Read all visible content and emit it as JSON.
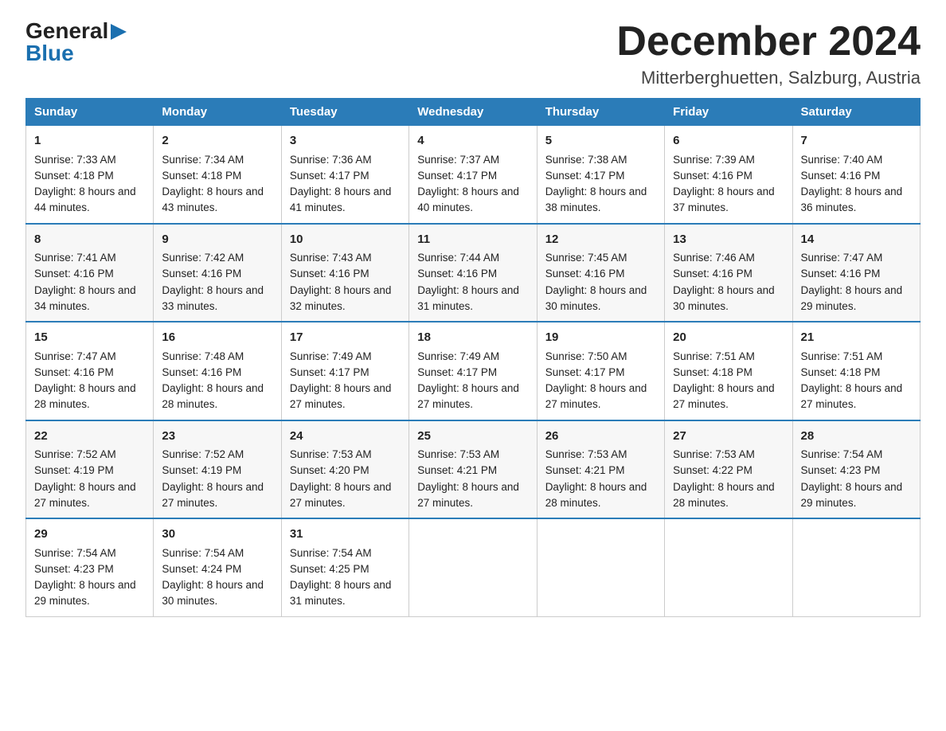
{
  "logo": {
    "line1": "General",
    "line2": "Blue",
    "arrow": "▶"
  },
  "header": {
    "title": "December 2024",
    "subtitle": "Mitterberghuetten, Salzburg, Austria"
  },
  "days_of_week": [
    "Sunday",
    "Monday",
    "Tuesday",
    "Wednesday",
    "Thursday",
    "Friday",
    "Saturday"
  ],
  "weeks": [
    [
      {
        "day": "1",
        "sunrise": "Sunrise: 7:33 AM",
        "sunset": "Sunset: 4:18 PM",
        "daylight": "Daylight: 8 hours and 44 minutes."
      },
      {
        "day": "2",
        "sunrise": "Sunrise: 7:34 AM",
        "sunset": "Sunset: 4:18 PM",
        "daylight": "Daylight: 8 hours and 43 minutes."
      },
      {
        "day": "3",
        "sunrise": "Sunrise: 7:36 AM",
        "sunset": "Sunset: 4:17 PM",
        "daylight": "Daylight: 8 hours and 41 minutes."
      },
      {
        "day": "4",
        "sunrise": "Sunrise: 7:37 AM",
        "sunset": "Sunset: 4:17 PM",
        "daylight": "Daylight: 8 hours and 40 minutes."
      },
      {
        "day": "5",
        "sunrise": "Sunrise: 7:38 AM",
        "sunset": "Sunset: 4:17 PM",
        "daylight": "Daylight: 8 hours and 38 minutes."
      },
      {
        "day": "6",
        "sunrise": "Sunrise: 7:39 AM",
        "sunset": "Sunset: 4:16 PM",
        "daylight": "Daylight: 8 hours and 37 minutes."
      },
      {
        "day": "7",
        "sunrise": "Sunrise: 7:40 AM",
        "sunset": "Sunset: 4:16 PM",
        "daylight": "Daylight: 8 hours and 36 minutes."
      }
    ],
    [
      {
        "day": "8",
        "sunrise": "Sunrise: 7:41 AM",
        "sunset": "Sunset: 4:16 PM",
        "daylight": "Daylight: 8 hours and 34 minutes."
      },
      {
        "day": "9",
        "sunrise": "Sunrise: 7:42 AM",
        "sunset": "Sunset: 4:16 PM",
        "daylight": "Daylight: 8 hours and 33 minutes."
      },
      {
        "day": "10",
        "sunrise": "Sunrise: 7:43 AM",
        "sunset": "Sunset: 4:16 PM",
        "daylight": "Daylight: 8 hours and 32 minutes."
      },
      {
        "day": "11",
        "sunrise": "Sunrise: 7:44 AM",
        "sunset": "Sunset: 4:16 PM",
        "daylight": "Daylight: 8 hours and 31 minutes."
      },
      {
        "day": "12",
        "sunrise": "Sunrise: 7:45 AM",
        "sunset": "Sunset: 4:16 PM",
        "daylight": "Daylight: 8 hours and 30 minutes."
      },
      {
        "day": "13",
        "sunrise": "Sunrise: 7:46 AM",
        "sunset": "Sunset: 4:16 PM",
        "daylight": "Daylight: 8 hours and 30 minutes."
      },
      {
        "day": "14",
        "sunrise": "Sunrise: 7:47 AM",
        "sunset": "Sunset: 4:16 PM",
        "daylight": "Daylight: 8 hours and 29 minutes."
      }
    ],
    [
      {
        "day": "15",
        "sunrise": "Sunrise: 7:47 AM",
        "sunset": "Sunset: 4:16 PM",
        "daylight": "Daylight: 8 hours and 28 minutes."
      },
      {
        "day": "16",
        "sunrise": "Sunrise: 7:48 AM",
        "sunset": "Sunset: 4:16 PM",
        "daylight": "Daylight: 8 hours and 28 minutes."
      },
      {
        "day": "17",
        "sunrise": "Sunrise: 7:49 AM",
        "sunset": "Sunset: 4:17 PM",
        "daylight": "Daylight: 8 hours and 27 minutes."
      },
      {
        "day": "18",
        "sunrise": "Sunrise: 7:49 AM",
        "sunset": "Sunset: 4:17 PM",
        "daylight": "Daylight: 8 hours and 27 minutes."
      },
      {
        "day": "19",
        "sunrise": "Sunrise: 7:50 AM",
        "sunset": "Sunset: 4:17 PM",
        "daylight": "Daylight: 8 hours and 27 minutes."
      },
      {
        "day": "20",
        "sunrise": "Sunrise: 7:51 AM",
        "sunset": "Sunset: 4:18 PM",
        "daylight": "Daylight: 8 hours and 27 minutes."
      },
      {
        "day": "21",
        "sunrise": "Sunrise: 7:51 AM",
        "sunset": "Sunset: 4:18 PM",
        "daylight": "Daylight: 8 hours and 27 minutes."
      }
    ],
    [
      {
        "day": "22",
        "sunrise": "Sunrise: 7:52 AM",
        "sunset": "Sunset: 4:19 PM",
        "daylight": "Daylight: 8 hours and 27 minutes."
      },
      {
        "day": "23",
        "sunrise": "Sunrise: 7:52 AM",
        "sunset": "Sunset: 4:19 PM",
        "daylight": "Daylight: 8 hours and 27 minutes."
      },
      {
        "day": "24",
        "sunrise": "Sunrise: 7:53 AM",
        "sunset": "Sunset: 4:20 PM",
        "daylight": "Daylight: 8 hours and 27 minutes."
      },
      {
        "day": "25",
        "sunrise": "Sunrise: 7:53 AM",
        "sunset": "Sunset: 4:21 PM",
        "daylight": "Daylight: 8 hours and 27 minutes."
      },
      {
        "day": "26",
        "sunrise": "Sunrise: 7:53 AM",
        "sunset": "Sunset: 4:21 PM",
        "daylight": "Daylight: 8 hours and 28 minutes."
      },
      {
        "day": "27",
        "sunrise": "Sunrise: 7:53 AM",
        "sunset": "Sunset: 4:22 PM",
        "daylight": "Daylight: 8 hours and 28 minutes."
      },
      {
        "day": "28",
        "sunrise": "Sunrise: 7:54 AM",
        "sunset": "Sunset: 4:23 PM",
        "daylight": "Daylight: 8 hours and 29 minutes."
      }
    ],
    [
      {
        "day": "29",
        "sunrise": "Sunrise: 7:54 AM",
        "sunset": "Sunset: 4:23 PM",
        "daylight": "Daylight: 8 hours and 29 minutes."
      },
      {
        "day": "30",
        "sunrise": "Sunrise: 7:54 AM",
        "sunset": "Sunset: 4:24 PM",
        "daylight": "Daylight: 8 hours and 30 minutes."
      },
      {
        "day": "31",
        "sunrise": "Sunrise: 7:54 AM",
        "sunset": "Sunset: 4:25 PM",
        "daylight": "Daylight: 8 hours and 31 minutes."
      },
      null,
      null,
      null,
      null
    ]
  ]
}
